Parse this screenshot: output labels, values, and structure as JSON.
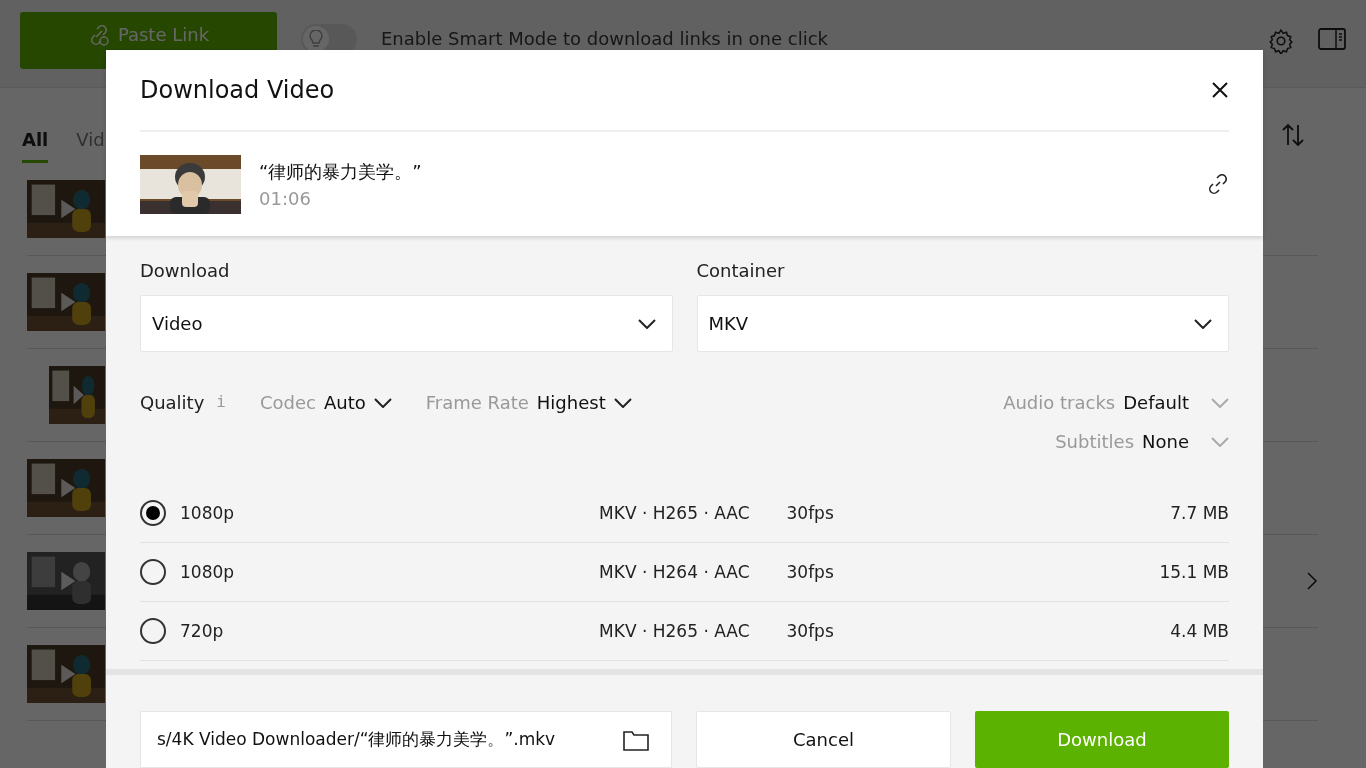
{
  "app": {
    "paste_button": "Paste Link",
    "smart_mode": {
      "on": false,
      "label": "Enable Smart Mode to download links in one click"
    },
    "tabs": [
      {
        "label": "All",
        "selected": true
      },
      {
        "label": "Vid",
        "selected": false
      }
    ],
    "items": [
      {
        "kind": "video"
      },
      {
        "kind": "video"
      },
      {
        "kind": "short"
      },
      {
        "kind": "video"
      },
      {
        "kind": "playlist"
      },
      {
        "kind": "video"
      }
    ]
  },
  "dialog": {
    "title": "Download Video",
    "video": {
      "title": "“律师的暴力美学。”",
      "duration": "01:06"
    },
    "fields": [
      {
        "label": "Download",
        "value": "Video"
      },
      {
        "label": "Container",
        "value": "MKV"
      }
    ],
    "quality_label": "Quality",
    "info": "i",
    "filters": [
      {
        "label": "Codec",
        "value": "Auto"
      },
      {
        "label": "Frame Rate",
        "value": "Highest"
      }
    ],
    "extras": [
      {
        "label": "Audio tracks",
        "value": "Default"
      },
      {
        "label": "Subtitles",
        "value": "None"
      }
    ],
    "formats": [
      {
        "resolution": "1080p",
        "format": "MKV · H265 · AAC",
        "fps": "30fps",
        "size": "7.7 MB",
        "selected": true
      },
      {
        "resolution": "1080p",
        "format": "MKV · H264 · AAC",
        "fps": "30fps",
        "size": "15.1 MB",
        "selected": false
      },
      {
        "resolution": "720p",
        "format": "MKV · H265 · AAC",
        "fps": "30fps",
        "size": "4.4 MB",
        "selected": false
      }
    ],
    "path": "s/4K Video Downloader/“律师的暴力美学。”.mkv",
    "cancel": "Cancel",
    "download": "Download"
  }
}
